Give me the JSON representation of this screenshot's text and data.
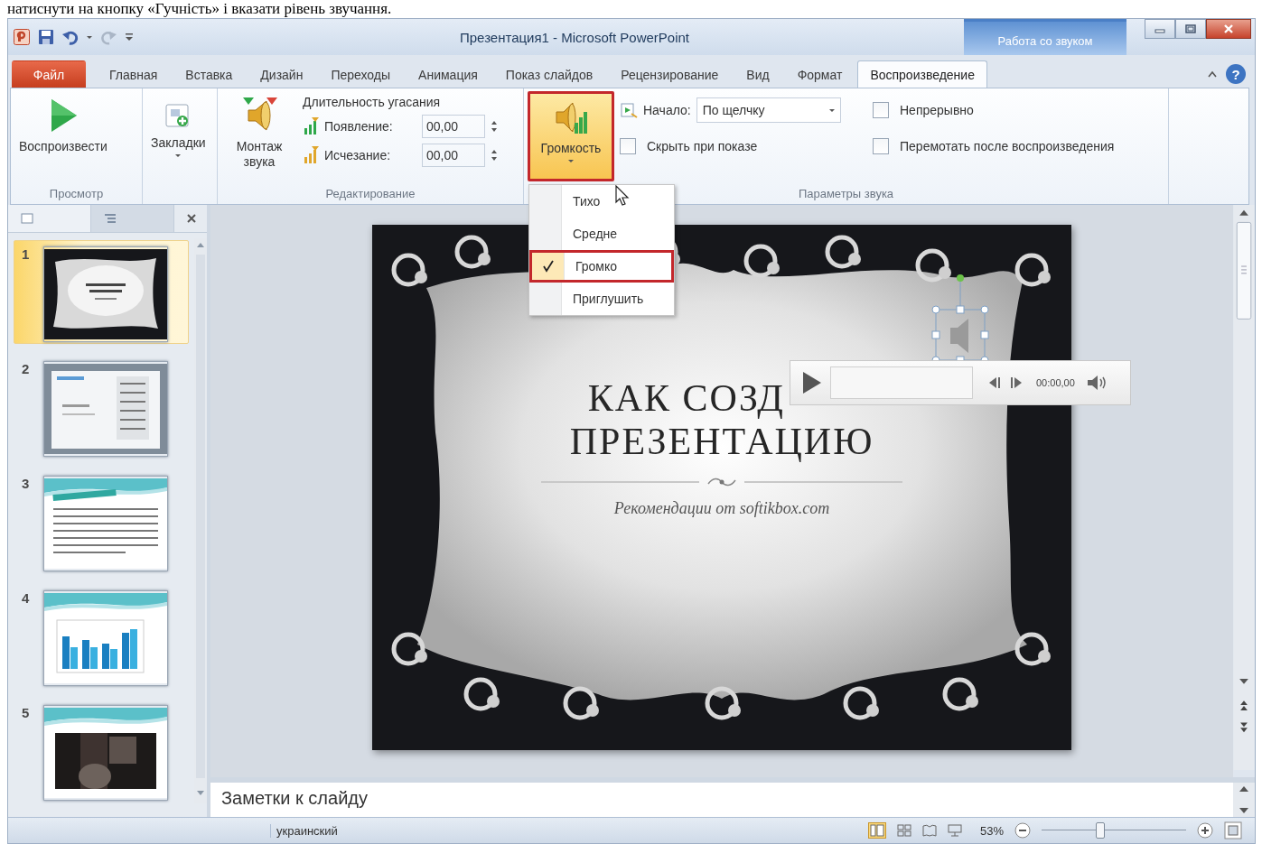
{
  "article_text": "натиснути на кнопку «Гучність» і вказати рівень звучання.",
  "window": {
    "title": "Презентация1 - Microsoft PowerPoint",
    "context_tab": "Работа со звуком"
  },
  "tabs": [
    {
      "label": "Файл",
      "kind": "file",
      "selected": false
    },
    {
      "label": "Главная",
      "kind": "tab",
      "selected": false
    },
    {
      "label": "Вставка",
      "kind": "tab",
      "selected": false
    },
    {
      "label": "Дизайн",
      "kind": "tab",
      "selected": false
    },
    {
      "label": "Переходы",
      "kind": "tab",
      "selected": false
    },
    {
      "label": "Анимация",
      "kind": "tab",
      "selected": false
    },
    {
      "label": "Показ слайдов",
      "kind": "tab",
      "selected": false
    },
    {
      "label": "Рецензирование",
      "kind": "tab",
      "selected": false
    },
    {
      "label": "Вид",
      "kind": "tab",
      "selected": false
    },
    {
      "label": "Формат",
      "kind": "tab",
      "selected": false
    },
    {
      "label": "Воспроизведение",
      "kind": "tab",
      "selected": true
    }
  ],
  "help_glyph": "?",
  "ribbon": {
    "preview": {
      "label": "Просмотр",
      "play_button": "Воспроизвести"
    },
    "bookmarks_button": "Закладки",
    "editing": {
      "label": "Редактирование",
      "trim_button": "Монтаж звука",
      "fade_title": "Длительность угасания",
      "fades": [
        {
          "label": "Появление:",
          "value": "00,00"
        },
        {
          "label": "Исчезание:",
          "value": "00,00"
        }
      ]
    },
    "audio_options": {
      "label": "Параметры звука",
      "volume_button": {
        "label": "Громкость",
        "pressed": true,
        "highlighted": true
      },
      "start": {
        "label": "Начало:",
        "value": "По щелчку"
      },
      "checkboxes": [
        {
          "label": "Непрерывно",
          "checked": false
        },
        {
          "label": "Скрыть при показе",
          "checked": false
        },
        {
          "label": "Перемотать после воспроизведения",
          "checked": false
        }
      ]
    }
  },
  "volume_menu": [
    {
      "label": "Тихо",
      "checked": false,
      "highlighted": false
    },
    {
      "label": "Средне",
      "checked": false,
      "highlighted": false
    },
    {
      "label": "Громко",
      "checked": true,
      "highlighted": true
    },
    {
      "label": "Приглушить",
      "checked": false,
      "highlighted": false
    }
  ],
  "panel_tabs": [
    {
      "kind": "slides",
      "selected": true
    },
    {
      "kind": "outline",
      "selected": false
    }
  ],
  "slides": [
    {
      "number": "1",
      "kind": "title",
      "selected": true
    },
    {
      "number": "2",
      "kind": "document",
      "selected": false
    },
    {
      "number": "3",
      "kind": "text",
      "selected": false
    },
    {
      "number": "4",
      "kind": "chart",
      "selected": false
    },
    {
      "number": "5",
      "kind": "photo",
      "selected": false
    }
  ],
  "slide": {
    "title_lines": [
      "КАК СОЗД",
      "ПРЕЗЕНТАЦИЮ"
    ],
    "subtitle": "Рекомендации от softikbox.com"
  },
  "audio_player": {
    "time": "00:00,00"
  },
  "notes": {
    "placeholder": "Заметки к слайду"
  },
  "status_bar": {
    "language": "украинский",
    "zoom": "53%",
    "zoom_slider": {
      "level": 0.4
    }
  }
}
